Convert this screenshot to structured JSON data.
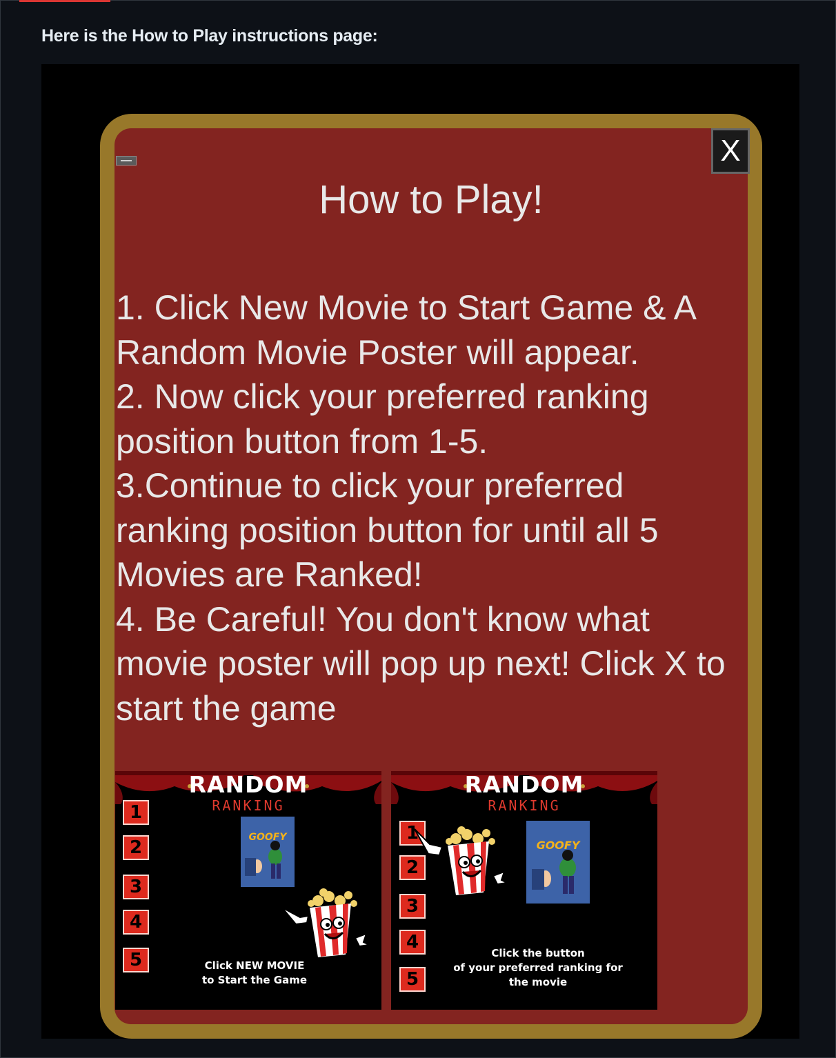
{
  "intro_text": "Here is the How to Play instructions page:",
  "colors": {
    "page_bg": "#0d1117",
    "modal_gold": "#98782a",
    "modal_red": "#832420",
    "button_red": "#dd2a1e"
  },
  "modal": {
    "title": "How to Play!",
    "close_label": "X",
    "instructions": [
      "1. Click New Movie to Start Game & A Random Movie Poster will appear.",
      "2. Now click your preferred ranking position button from 1-5.",
      "3.Continue to click your preferred ranking position button for until all 5 Movies are Ranked!",
      "4. Be Careful! You don't know what movie poster will pop up next! Click X to start the game"
    ]
  },
  "thumbnails": [
    {
      "title": "RANDOM",
      "subtitle": "RANKING",
      "ranks": [
        "1",
        "2",
        "3",
        "4",
        "5"
      ],
      "poster_title": "GOOFY",
      "caption_line1": "Click NEW MOVIE",
      "caption_line2": "to Start the Game"
    },
    {
      "title": "RANDOM",
      "subtitle": "RANKING",
      "ranks": [
        "1",
        "2",
        "3",
        "4",
        "5"
      ],
      "poster_title": "GOOFY",
      "caption_line1": "Click the button",
      "caption_line2": "of your preferred ranking for",
      "caption_line3": "the movie"
    }
  ]
}
